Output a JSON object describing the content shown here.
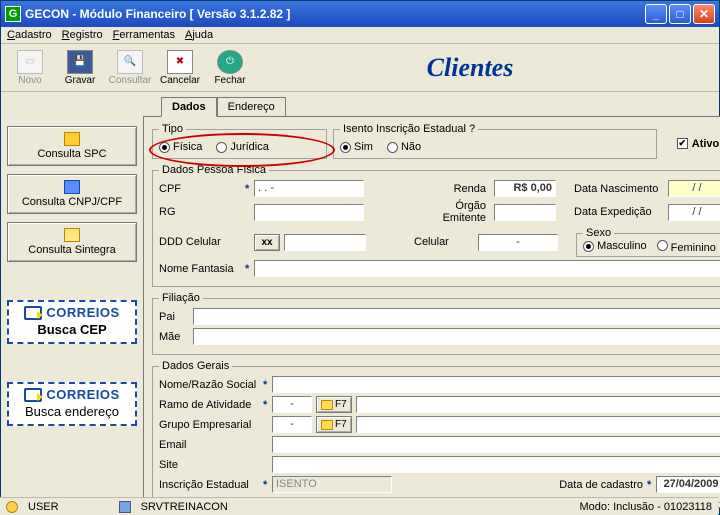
{
  "window": {
    "icon_text": "G",
    "title": "GECON  -  Módulo Financeiro     [ Versão 3.1.2.82 ]"
  },
  "menu": {
    "cadastro": "Cadastro",
    "registro": "Registro",
    "ferramentas": "Ferramentas",
    "ajuda": "Ajuda"
  },
  "toolbar": {
    "novo": "Novo",
    "gravar": "Gravar",
    "consultar": "Consultar",
    "cancelar": "Cancelar",
    "fechar": "Fechar",
    "page_title": "Clientes"
  },
  "sidebar": {
    "spc": "Consulta SPC",
    "cnpj": "Consulta CNPJ/CPF",
    "sintegra": "Consulta Sintegra",
    "correios_brand": "CORREIOS",
    "busca_cep": "Busca CEP",
    "busca_endereco": "Busca endereço"
  },
  "tabs": {
    "dados": "Dados",
    "endereco": "Endereço"
  },
  "tipo": {
    "legend": "Tipo",
    "fisica": "Física",
    "juridica": "Jurídica"
  },
  "isento": {
    "legend": "Isento Inscrição Estadual ?",
    "sim": "Sim",
    "nao": "Não"
  },
  "ativo_label": "Ativo",
  "pf": {
    "legend": "Dados Pessoa Física",
    "cpf": "CPF",
    "cpf_val": "   .   .   -",
    "renda": "Renda",
    "renda_val": "R$ 0,00",
    "data_nasc": "Data Nascimento",
    "data_nasc_val": "  /  /",
    "rg": "RG",
    "orgao": "Órgão Emitente",
    "data_exp": "Data Expedição",
    "data_exp_val": "  /  /",
    "ddd": "DDD Celular",
    "ddd_btn": "xx",
    "celular": "Celular",
    "celular_val": "-",
    "sexo_legend": "Sexo",
    "masc": "Masculino",
    "fem": "Feminino",
    "nome_fantasia": "Nome Fantasia"
  },
  "filiacao": {
    "legend": "Filiação",
    "pai": "Pai",
    "mae": "Mãe"
  },
  "gerais": {
    "legend": "Dados Gerais",
    "nome_razao": "Nome/Razão Social",
    "ramo": "Ramo de Atividade",
    "ramo_val": "-",
    "f7": "F7",
    "grupo": "Grupo Empresarial",
    "grupo_val": "-",
    "email": "Email",
    "site": "Site",
    "inscricao": "Inscrição Estadual",
    "inscricao_val": "ISENTO",
    "data_cadastro": "Data de cadastro",
    "data_cadastro_val": "27/04/2009"
  },
  "status": {
    "user": "USER",
    "server": "SRVTREINACON",
    "mode": "Modo:    Inclusão - 01023118"
  }
}
